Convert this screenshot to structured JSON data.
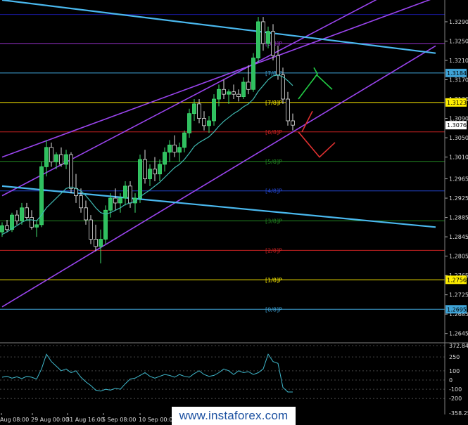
{
  "chart_data": {
    "type": "candlestick",
    "price_axis": {
      "range": [
        1.263,
        1.3335
      ],
      "ticks": [
        "1.3290",
        "1.3250",
        "1.3210",
        "1.3170",
        "1.3130",
        "1.3090",
        "1.3050",
        "1.3010",
        "1.2965",
        "1.2925",
        "1.2885",
        "1.2845",
        "1.2805",
        "1.2765",
        "1.2725",
        "1.2685",
        "1.2645"
      ]
    },
    "price_tags": [
      {
        "label": "1.3184",
        "value": 1.3184,
        "color": "#3fa3d6"
      },
      {
        "label": "1.3123",
        "value": 1.3123,
        "color": "#ffee00"
      },
      {
        "label": "1.3076",
        "value": 1.3076,
        "color": "#ffffff"
      },
      {
        "label": "1.2756",
        "value": 1.2756,
        "color": "#ffee00"
      },
      {
        "label": "1.2695",
        "value": 1.2695,
        "color": "#3fa3d6"
      }
    ],
    "murrey_levels": [
      {
        "label": "",
        "value": 1.3305,
        "color": "#1a1aa0"
      },
      {
        "label": "[8/8]P",
        "value": 1.3245,
        "color": "#9933cc"
      },
      {
        "label": "[7/8]P",
        "value": 1.3184,
        "color": "#3fa3d6"
      },
      {
        "label": "[7/8]P",
        "value": 1.3123,
        "color": "#ffee00"
      },
      {
        "label": "[6/8]P",
        "value": 1.3062,
        "color": "#cc2222"
      },
      {
        "label": "[5/8]P",
        "value": 1.3001,
        "color": "#228822"
      },
      {
        "label": "[4/8]P",
        "value": 1.294,
        "color": "#2244cc"
      },
      {
        "label": "[3/8]P",
        "value": 1.2878,
        "color": "#228822"
      },
      {
        "label": "[2/8]P",
        "value": 1.2817,
        "color": "#cc2222"
      },
      {
        "label": "[1/8]P",
        "value": 1.2756,
        "color": "#ffee00"
      },
      {
        "label": "[0/8]P",
        "value": 1.2695,
        "color": "#3fa3d6"
      }
    ],
    "time_labels": [
      "Aug 08:00",
      "29 Aug 00:00",
      "31 Aug 16:00",
      "5 Sep 08:00",
      "10 Sep 00:00"
    ],
    "candles": [
      [
        1.2855,
        1.2875,
        1.2845,
        1.2868
      ],
      [
        1.2868,
        1.288,
        1.2855,
        1.286
      ],
      [
        1.286,
        1.2895,
        1.2855,
        1.289
      ],
      [
        1.289,
        1.29,
        1.287,
        1.2878
      ],
      [
        1.2878,
        1.2915,
        1.287,
        1.2905
      ],
      [
        1.2905,
        1.2915,
        1.288,
        1.2885
      ],
      [
        1.2885,
        1.29,
        1.286,
        1.2865
      ],
      [
        1.2865,
        1.288,
        1.2845,
        1.287
      ],
      [
        1.287,
        1.3,
        1.2865,
        1.299
      ],
      [
        1.299,
        1.3045,
        1.297,
        1.303
      ],
      [
        1.303,
        1.304,
        1.299,
        1.3
      ],
      [
        1.3,
        1.302,
        1.2985,
        1.3015
      ],
      [
        1.3015,
        1.303,
        1.299,
        1.2995
      ],
      [
        1.2995,
        1.3025,
        1.2985,
        1.3015
      ],
      [
        1.3015,
        1.302,
        1.2935,
        1.2945
      ],
      [
        1.2945,
        1.2975,
        1.2915,
        1.293
      ],
      [
        1.293,
        1.2945,
        1.2895,
        1.2905
      ],
      [
        1.2905,
        1.292,
        1.287,
        1.288
      ],
      [
        1.288,
        1.289,
        1.283,
        1.284
      ],
      [
        1.284,
        1.287,
        1.2815,
        1.2825
      ],
      [
        1.2825,
        1.286,
        1.279,
        1.284
      ],
      [
        1.284,
        1.291,
        1.283,
        1.29
      ],
      [
        1.29,
        1.2935,
        1.2885,
        1.2925
      ],
      [
        1.2925,
        1.2945,
        1.29,
        1.2915
      ],
      [
        1.2915,
        1.2935,
        1.2895,
        1.2925
      ],
      [
        1.2925,
        1.296,
        1.291,
        1.295
      ],
      [
        1.295,
        1.296,
        1.2905,
        1.2915
      ],
      [
        1.2915,
        1.2935,
        1.2895,
        1.2925
      ],
      [
        1.2925,
        1.3015,
        1.2915,
        1.3005
      ],
      [
        1.3005,
        1.3025,
        1.2955,
        1.2965
      ],
      [
        1.2965,
        1.2995,
        1.295,
        1.2985
      ],
      [
        1.2985,
        1.301,
        1.296,
        1.2975
      ],
      [
        1.2975,
        1.3005,
        1.296,
        1.2995
      ],
      [
        1.2995,
        1.303,
        1.298,
        1.302
      ],
      [
        1.302,
        1.3045,
        1.3,
        1.3035
      ],
      [
        1.3035,
        1.3055,
        1.301,
        1.302
      ],
      [
        1.302,
        1.304,
        1.3,
        1.303
      ],
      [
        1.303,
        1.3065,
        1.302,
        1.306
      ],
      [
        1.306,
        1.311,
        1.305,
        1.31
      ],
      [
        1.31,
        1.313,
        1.3085,
        1.312
      ],
      [
        1.312,
        1.313,
        1.308,
        1.309
      ],
      [
        1.309,
        1.3105,
        1.3065,
        1.3075
      ],
      [
        1.3075,
        1.3095,
        1.306,
        1.3085
      ],
      [
        1.3085,
        1.314,
        1.3075,
        1.313
      ],
      [
        1.313,
        1.316,
        1.3115,
        1.315
      ],
      [
        1.315,
        1.317,
        1.313,
        1.314
      ],
      [
        1.314,
        1.315,
        1.312,
        1.3145
      ],
      [
        1.3145,
        1.316,
        1.313,
        1.314
      ],
      [
        1.314,
        1.315,
        1.3125,
        1.3135
      ],
      [
        1.3135,
        1.3175,
        1.313,
        1.3165
      ],
      [
        1.3165,
        1.32,
        1.314,
        1.315
      ],
      [
        1.315,
        1.3225,
        1.3145,
        1.3215
      ],
      [
        1.3215,
        1.33,
        1.3205,
        1.329
      ],
      [
        1.329,
        1.33,
        1.323,
        1.3245
      ],
      [
        1.3245,
        1.328,
        1.3235,
        1.327
      ],
      [
        1.327,
        1.3285,
        1.321,
        1.322
      ],
      [
        1.322,
        1.324,
        1.317,
        1.318
      ],
      [
        1.318,
        1.3195,
        1.312,
        1.313
      ],
      [
        1.313,
        1.3145,
        1.3075,
        1.3085
      ],
      [
        1.3085,
        1.31,
        1.3065,
        1.3076
      ]
    ],
    "moving_average": [
      1.285,
      1.2855,
      1.2862,
      1.2868,
      1.2875,
      1.288,
      1.288,
      1.2878,
      1.289,
      1.2905,
      1.2915,
      1.2925,
      1.2935,
      1.2945,
      1.2948,
      1.2945,
      1.294,
      1.293,
      1.2918,
      1.2905,
      1.2895,
      1.2892,
      1.2895,
      1.29,
      1.2905,
      1.2912,
      1.2915,
      1.2918,
      1.2928,
      1.2935,
      1.2942,
      1.295,
      1.2958,
      1.2968,
      1.2978,
      1.2988,
      1.2995,
      1.3005,
      1.3018,
      1.3032,
      1.304,
      1.3046,
      1.3052,
      1.3062,
      1.3074,
      1.3084,
      1.3092,
      1.31,
      1.3106,
      1.3114,
      1.312,
      1.313,
      1.3146,
      1.3158,
      1.317,
      1.3178,
      1.318,
      1.3176,
      1.3168,
      1.3158
    ],
    "trend_lines": [
      {
        "name": "upper-channel",
        "color": "#9a44ee",
        "from": [
          0,
          1.301
        ],
        "to": [
          88,
          1.334
        ]
      },
      {
        "name": "mid-channel",
        "color": "#9a44ee",
        "from": [
          0,
          1.293
        ],
        "to": [
          88,
          1.34
        ]
      },
      {
        "name": "lower-channel",
        "color": "#9a44ee",
        "from": [
          0,
          1.27
        ],
        "to": [
          88,
          1.324
        ]
      },
      {
        "name": "top-descending",
        "color": "#4ab8ee",
        "from": [
          0,
          1.3335
        ],
        "to": [
          88,
          1.3225
        ]
      },
      {
        "name": "bottom-descending",
        "color": "#4ab8ee",
        "from": [
          0,
          1.295
        ],
        "to": [
          88,
          1.2865
        ]
      }
    ],
    "indicator": {
      "range": [
        -358.25,
        372.85
      ],
      "ticks": [
        "372.8496",
        "250",
        "100",
        "0",
        "-100",
        "-200",
        "-358.25"
      ],
      "values": [
        30,
        40,
        20,
        35,
        15,
        40,
        30,
        10,
        120,
        280,
        200,
        150,
        100,
        120,
        80,
        100,
        30,
        -20,
        -60,
        -110,
        -120,
        -100,
        -110,
        -90,
        -100,
        -40,
        10,
        20,
        50,
        80,
        40,
        20,
        40,
        60,
        50,
        30,
        60,
        40,
        30,
        70,
        100,
        60,
        40,
        50,
        80,
        120,
        100,
        60,
        100,
        80,
        90,
        60,
        80,
        120,
        280,
        200,
        180,
        -80,
        -130,
        -130
      ]
    },
    "arrows": [
      {
        "name": "bullish-arrow",
        "color": "#22cc44"
      },
      {
        "name": "bearish-arrow",
        "color": "#e03030"
      }
    ]
  },
  "watermark": "www.instaforex.com"
}
